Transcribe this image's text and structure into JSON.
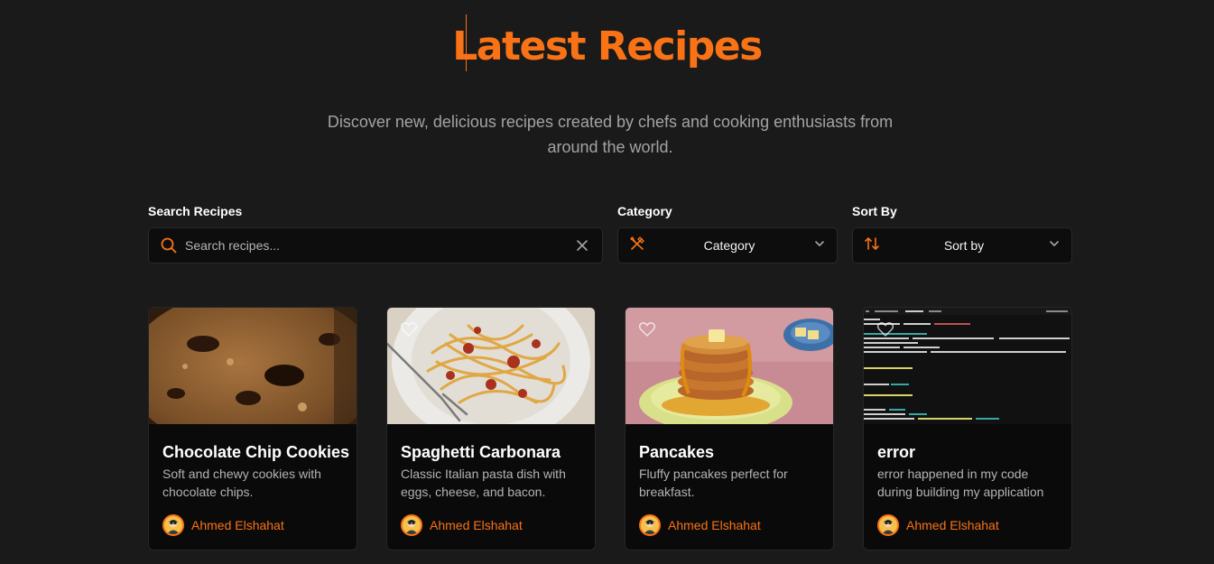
{
  "header": {
    "title": "Latest Recipes",
    "subtitle": "Discover new, delicious recipes created by chefs and cooking enthusiasts from around the world."
  },
  "filters": {
    "search_label": "Search Recipes",
    "search_placeholder": "Search recipes...",
    "search_value": "",
    "category_label": "Category",
    "category_value": "Category",
    "sort_label": "Sort By",
    "sort_value": "Sort by"
  },
  "recipes": [
    {
      "name": "Chocolate Chip Cookies",
      "description": "Soft and chewy cookies with chocolate chips.",
      "author": "Ahmed Elshahat"
    },
    {
      "name": "Spaghetti Carbonara",
      "description": "Classic Italian pasta dish with eggs, cheese, and bacon.",
      "author": "Ahmed Elshahat"
    },
    {
      "name": "Pancakes",
      "description": "Fluffy pancakes perfect for breakfast.",
      "author": "Ahmed Elshahat"
    },
    {
      "name": "error",
      "description": "error happened in my code during building my application",
      "author": "Ahmed Elshahat"
    }
  ],
  "colors": {
    "background": "#1a1a1a",
    "accent": "#f97316",
    "card": "#0a0a0a"
  },
  "icons": {
    "search": "search-icon",
    "clear": "close-icon",
    "category": "utensils-crossed-icon",
    "sort": "sort-arrows-icon",
    "chevron": "chevron-down-icon",
    "favorite": "heart-icon"
  }
}
